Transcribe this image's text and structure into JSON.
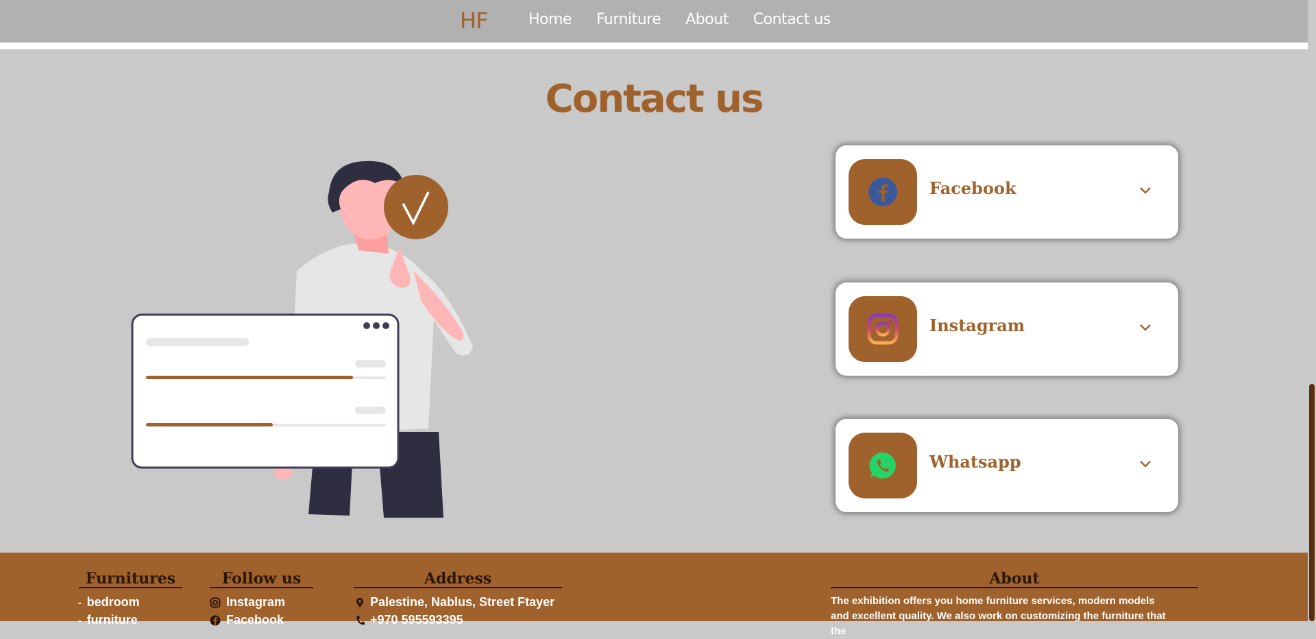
{
  "nav": {
    "logo": "HF",
    "links": [
      {
        "label": "Home"
      },
      {
        "label": "Furniture"
      },
      {
        "label": "About"
      },
      {
        "label": "Contact us"
      }
    ]
  },
  "main": {
    "title": "Contact us",
    "cards": [
      {
        "label": "Facebook",
        "icon": "facebook-icon"
      },
      {
        "label": "Instagram",
        "icon": "instagram-icon"
      },
      {
        "label": "Whatsapp",
        "icon": "whatsapp-icon"
      }
    ]
  },
  "footer": {
    "furnitures": {
      "heading": "Furnitures",
      "items": [
        "bedroom",
        "furniture"
      ]
    },
    "follow": {
      "heading": "Follow us",
      "items": [
        "Instagram",
        "Facebook"
      ]
    },
    "address": {
      "heading": "Address",
      "items": [
        "Palestine, Nablus, Street Ftayer",
        "+970 595593395"
      ]
    },
    "about": {
      "heading": "About",
      "text": "The exhibition offers you home furniture services, modern models and excellent quality. We also work on customizing the furniture that the"
    }
  },
  "colors": {
    "brand": "#a0622c",
    "nav_bg": "#b1b1b1",
    "page_bg": "#c9c9c9",
    "footer_heading": "#2b1608"
  }
}
